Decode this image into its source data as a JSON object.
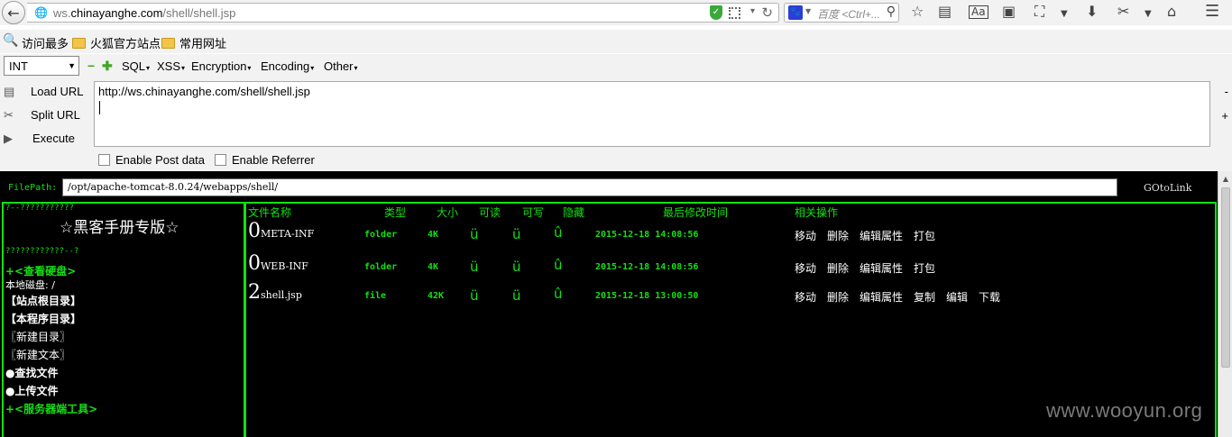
{
  "browser": {
    "url_prefix": "ws.",
    "url_domain": "chinayanghe.com",
    "url_path": "/shell/shell.jsp",
    "search_placeholder": "百度 <Ctrl+...",
    "icons": [
      "back-icon",
      "globe-icon",
      "shield-icon",
      "qr-icon",
      "reload-icon",
      "baidu-icon",
      "search-icon",
      "star-icon",
      "reading-list-icon",
      "reader-view-icon",
      "pocket-icon",
      "crop-icon",
      "download-icon",
      "screenshot-icon",
      "home-icon",
      "menu-icon"
    ]
  },
  "bookmarks": [
    "访问最多",
    "火狐官方站点",
    "常用网址"
  ],
  "hackbar": {
    "select_value": "INT",
    "menus": [
      "SQL",
      "XSS",
      "Encryption",
      "Encoding",
      "Other"
    ],
    "buttons": [
      "Load URL",
      "Split URL",
      "Execute"
    ],
    "url_value": "http://ws.chinayanghe.com/shell/shell.jsp",
    "checkboxes": [
      "Enable Post data",
      "Enable Referrer"
    ],
    "side_minus": "-",
    "side_plus": "+"
  },
  "shell": {
    "filepath_label": "FilePath:",
    "filepath_value": "/opt/apache-tomcat-8.0.24/webapps/shell/",
    "goto_label": "GOtoLink",
    "garbled_top": "?--???????????",
    "brand": "☆黑客手册专版☆",
    "garbled_bottom": "????????????--?",
    "view_disk": "+<查看硬盘>",
    "local_disk": "本地磁盘: /",
    "site_root": "【站点根目录】",
    "program_dir": "【本程序目录】",
    "new_dir": "〖新建目录〗",
    "new_text": "〖新建文本〗",
    "find_file": "●查找文件",
    "upload_file": "●上传文件",
    "server_tools": "+<服务器端工具>",
    "headers": {
      "name": "文件名称",
      "type": "类型",
      "size": "大小",
      "readable": "可读",
      "writable": "可写",
      "hidden": "隐藏",
      "mtime": "最后修改时间",
      "actions": "相关操作"
    },
    "files": [
      {
        "num": "0",
        "name": "META-INF",
        "type": "folder",
        "size": "4K",
        "r": "ü",
        "w": "ü",
        "h": "û",
        "mtime": "2015-12-18 14:08:56",
        "actions": [
          "移动",
          "删除",
          "编辑属性",
          "打包"
        ]
      },
      {
        "num": "0",
        "name": "WEB-INF",
        "type": "folder",
        "size": "4K",
        "r": "ü",
        "w": "ü",
        "h": "û",
        "mtime": "2015-12-18 14:08:56",
        "actions": [
          "移动",
          "删除",
          "编辑属性",
          "打包"
        ]
      },
      {
        "num": "2",
        "name": "shell.jsp",
        "type": "file",
        "size": "42K",
        "r": "ü",
        "w": "ü",
        "h": "û",
        "mtime": "2015-12-18 13:00:50",
        "actions": [
          "移动",
          "删除",
          "编辑属性",
          "复制",
          "编辑",
          "下载"
        ]
      }
    ]
  },
  "watermark": "www.wooyun.org"
}
